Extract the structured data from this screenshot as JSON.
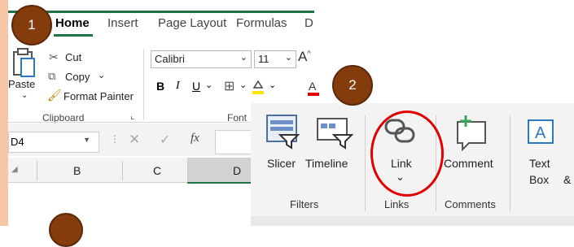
{
  "tabs": [
    "Home",
    "Insert",
    "Page Layout",
    "Formulas",
    "D"
  ],
  "clipboard": {
    "paste": "Paste",
    "cut": "Cut",
    "copy": "Copy",
    "format_painter": "Format Painter",
    "group_label": "Clipboard",
    "launcher": "⌞"
  },
  "font": {
    "name": "Calibri",
    "size": "11",
    "bold": "B",
    "italic": "I",
    "underline": "U",
    "group_label": "Font"
  },
  "sheet": {
    "name_box": "D4",
    "fx": "fx",
    "columns": [
      "B",
      "C",
      "D"
    ]
  },
  "insert_ribbon": {
    "slicer": "Slicer",
    "timeline": "Timeline",
    "link": "Link",
    "link_dropdown": "⌄",
    "comment": "Comment",
    "textbox_line1": "Text",
    "textbox_line2": "Box",
    "group_filters": "Filters",
    "group_links": "Links",
    "group_comments": "Comments"
  },
  "steps": [
    "1",
    "2"
  ],
  "colors": {
    "excel_green": "#217346",
    "step_circle": "#843c0c",
    "highlight_ring": "#e00000"
  }
}
